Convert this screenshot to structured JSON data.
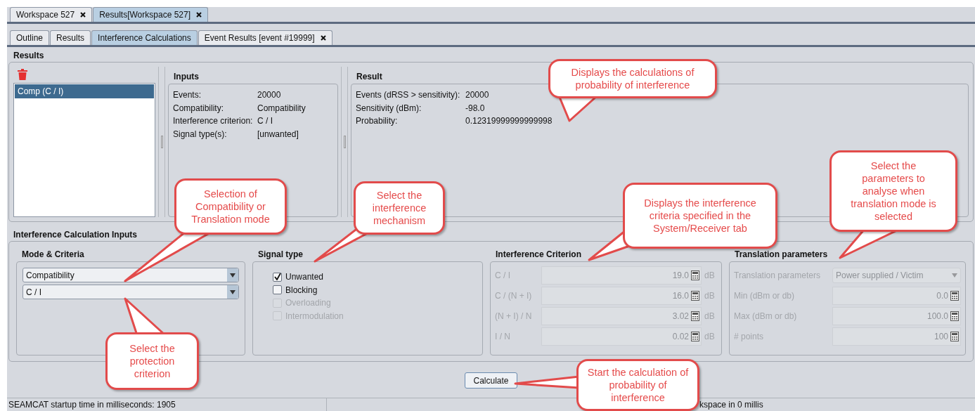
{
  "workspace_tabs": [
    {
      "label": "Workspace 527",
      "selected": false,
      "closable": true
    },
    {
      "label": "Results[Workspace 527]",
      "selected": true,
      "closable": true
    }
  ],
  "view_tabs": [
    {
      "label": "Outline",
      "selected": false,
      "closable": false
    },
    {
      "label": "Results",
      "selected": false,
      "closable": false
    },
    {
      "label": "Interference Calculations",
      "selected": true,
      "closable": false
    },
    {
      "label": "Event Results [event #19999]",
      "selected": false,
      "closable": true
    }
  ],
  "results": {
    "title": "Results",
    "list": [
      {
        "label": "Comp (C / I)",
        "selected": true
      }
    ],
    "inputs": {
      "title": "Inputs",
      "rows": [
        {
          "label": "Events:",
          "value": "20000"
        },
        {
          "label": "Compatibility:",
          "value": "Compatibility"
        },
        {
          "label": "Interference criterion:",
          "value": "C / I"
        },
        {
          "label": "Signal type(s):",
          "value": "[unwanted]"
        }
      ]
    },
    "result": {
      "title": "Result",
      "rows": [
        {
          "label": "Events (dRSS > sensitivity):",
          "value": "20000"
        },
        {
          "label": "Sensitivity (dBm):",
          "value": "-98.0"
        },
        {
          "label": "Probability:",
          "value": "0.12319999999999998"
        }
      ]
    }
  },
  "calculation_inputs": {
    "title": "Interference Calculation Inputs",
    "mode_criteria": {
      "title": "Mode & Criteria",
      "dropdowns": [
        "Compatibility",
        "C / I"
      ]
    },
    "signal_type": {
      "title": "Signal type",
      "options": [
        {
          "label": "Unwanted",
          "checked": true,
          "disabled": false
        },
        {
          "label": "Blocking",
          "checked": false,
          "disabled": false
        },
        {
          "label": "Overloading",
          "checked": false,
          "disabled": true
        },
        {
          "label": "Intermodulation",
          "checked": false,
          "disabled": true
        }
      ]
    },
    "interference_criterion": {
      "title": "Interference Criterion",
      "disabled": true,
      "rows": [
        {
          "label": "C / I",
          "value": "19.0",
          "unit": "dB"
        },
        {
          "label": "C / (N + I)",
          "value": "16.0",
          "unit": "dB"
        },
        {
          "label": "(N + I) / N",
          "value": "3.02",
          "unit": "dB"
        },
        {
          "label": "I / N",
          "value": "0.02",
          "unit": "dB"
        }
      ]
    },
    "translation_parameters": {
      "title": "Translation parameters",
      "disabled": true,
      "rows": [
        {
          "kind": "dropdown",
          "label": "Translation parameters",
          "value": "Power supplied / Victim"
        },
        {
          "kind": "number",
          "label": "Min (dBm or db)",
          "value": "0.0"
        },
        {
          "kind": "number",
          "label": "Max (dBm or db)",
          "value": "100.0"
        },
        {
          "kind": "number",
          "label": "# points",
          "value": "100"
        }
      ]
    }
  },
  "calculate_button": "Calculate",
  "status_bar": [
    "SEAMCAT startup time in milliseconds: 1905",
    "kspace in 0 millis"
  ],
  "callouts": [
    "Displays the calculations of probability of interference",
    "Selection of Compatibility or Translation mode",
    "Select the interference mechanism",
    "Displays the interference criteria specified in the System/Receiver tab",
    "Select the parameters to analyse when translation mode is selected",
    "Select the protection criterion",
    "Start the calculation of probability of interference"
  ]
}
